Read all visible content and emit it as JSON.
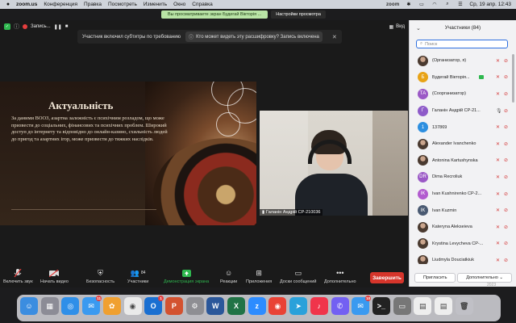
{
  "menubar": {
    "app": "zoom.us",
    "items": [
      "Конференция",
      "Правка",
      "Посмотреть",
      "Изменить",
      "Окно",
      "Справка"
    ],
    "zoom_label": "zoom",
    "datetime": "Ср, 19 апр.  12:43"
  },
  "share_banner": {
    "message": "Вы просматриваете экран Будегай Вікторія ...",
    "options": "Настройки просмотра"
  },
  "meeting": {
    "recording_label": "Запись...",
    "view_label": "Вид",
    "subtitle_notice": "Участник включил субтитры по требованию",
    "subtitle_question": "Кто может видеть эту расшифровку? Запись включена",
    "close": "✕"
  },
  "slide": {
    "title": "Актуальність",
    "body": "За даними ВООЗ, азартна залежність є психічним розладом, що може призвести до соціальних, фінансових та психічних проблем. Широкий доступ до інтернету та відповідно до онлайн-казино, схильність людей до пригод та азартних ігор, може призвести до тяжких наслідків."
  },
  "video": {
    "name": "Галанін Андрій СР-210036"
  },
  "toolbar": {
    "items": [
      {
        "label": "Включить звук",
        "icon": "mic-off-icon"
      },
      {
        "label": "Начать видео",
        "icon": "video-off-icon"
      },
      {
        "label": "Безопасность",
        "icon": "shield-icon"
      },
      {
        "label": "Участники",
        "icon": "participants-icon",
        "count": "84"
      },
      {
        "label": "Демонстрация экрана",
        "icon": "share-screen-icon"
      },
      {
        "label": "Реакции",
        "icon": "reactions-icon"
      },
      {
        "label": "Приложения",
        "icon": "apps-icon"
      },
      {
        "label": "Доски сообщений",
        "icon": "whiteboard-icon"
      },
      {
        "label": "Дополнительно",
        "icon": "more-icon"
      }
    ],
    "end": "Завершить"
  },
  "panel": {
    "title": "Участники (84)",
    "search_placeholder": "Поиск",
    "participants": [
      {
        "initial": "",
        "name": "(Организатор, я)",
        "color": "#6b5a4e",
        "photo": true
      },
      {
        "initial": "Б",
        "name": "Будегай Вікторія...",
        "color": "#e8a317"
      },
      {
        "initial": "ТА",
        "name": "(Соорганизатор)",
        "color": "#9b59c6"
      },
      {
        "initial": "Г",
        "name": "Галанін Андрій СР-21...",
        "color": "#8e5bc9"
      },
      {
        "initial": "1",
        "name": "137869",
        "color": "#2d8fe0"
      },
      {
        "initial": "",
        "name": "Alexander Ivanchenko",
        "color": "#6b4a3a",
        "photo": true
      },
      {
        "initial": "",
        "name": "Antonina Kartushynska",
        "color": "#5e4638",
        "photo": true
      },
      {
        "initial": "DR",
        "name": "Dima Recroliuk",
        "color": "#9b59c6"
      },
      {
        "initial": "IK",
        "name": "Ivan Kushnirenko СР-2...",
        "color": "#b25bcf"
      },
      {
        "initial": "IK",
        "name": "Ivan Kuzmin",
        "color": "#4a5a72"
      },
      {
        "initial": "",
        "name": "Kateryna Alekseieva",
        "color": "#7a5444",
        "photo": true
      },
      {
        "initial": "",
        "name": "Krystina Levycheva СР-...",
        "color": "#6a4c40",
        "photo": true
      },
      {
        "initial": "",
        "name": "Liudmyla Douciatkiuk",
        "color": "#5c4a40",
        "photo": true
      }
    ],
    "invite": "Пригласить",
    "more": "Дополнительно ⌄"
  },
  "dock": {
    "year": "2023",
    "apps": [
      {
        "name": "finder-icon",
        "color": "#3b8de0",
        "glyph": "☺"
      },
      {
        "name": "launchpad-icon",
        "color": "#8c8c96",
        "glyph": "▦"
      },
      {
        "name": "safari-icon",
        "color": "#2f8fe8",
        "glyph": "◎"
      },
      {
        "name": "mail-icon",
        "color": "#3a9af0",
        "glyph": "✉",
        "badge": "11"
      },
      {
        "name": "photos-icon",
        "color": "#f0a030",
        "glyph": "✿"
      },
      {
        "name": "chrome-icon",
        "color": "#eaeaea",
        "glyph": "◉"
      },
      {
        "name": "outlook-icon",
        "color": "#1a6fd1",
        "glyph": "O",
        "badge": "1"
      },
      {
        "name": "powerpoint-icon",
        "color": "#d35230",
        "glyph": "P"
      },
      {
        "name": "settings-icon",
        "color": "#8e8e93",
        "glyph": "⚙"
      },
      {
        "name": "word-icon",
        "color": "#2b579a",
        "glyph": "W"
      },
      {
        "name": "excel-icon",
        "color": "#217346",
        "glyph": "X"
      },
      {
        "name": "zoom-icon",
        "color": "#2d8cff",
        "glyph": "z"
      },
      {
        "name": "chrome2-icon",
        "color": "#e94235",
        "glyph": "◉"
      },
      {
        "name": "telegram-icon",
        "color": "#2aa1da",
        "glyph": "➤"
      },
      {
        "name": "music-icon",
        "color": "#f0354b",
        "glyph": "♪"
      },
      {
        "name": "viber-icon",
        "color": "#7360f2",
        "glyph": "✆"
      },
      {
        "name": "messages-icon",
        "color": "#3a9af0",
        "glyph": "✉",
        "badge": "10"
      },
      {
        "name": "terminal-icon",
        "color": "#222",
        "glyph": ">_"
      },
      {
        "name": "screenshot-icon",
        "color": "#777",
        "glyph": "▭"
      },
      {
        "name": "document-icon",
        "color": "#eeeeee",
        "glyph": "▤"
      },
      {
        "name": "document2-icon",
        "color": "#eeeeee",
        "glyph": "▤"
      },
      {
        "name": "trash-icon",
        "color": "#c0c0c6",
        "glyph": "🗑"
      }
    ]
  }
}
